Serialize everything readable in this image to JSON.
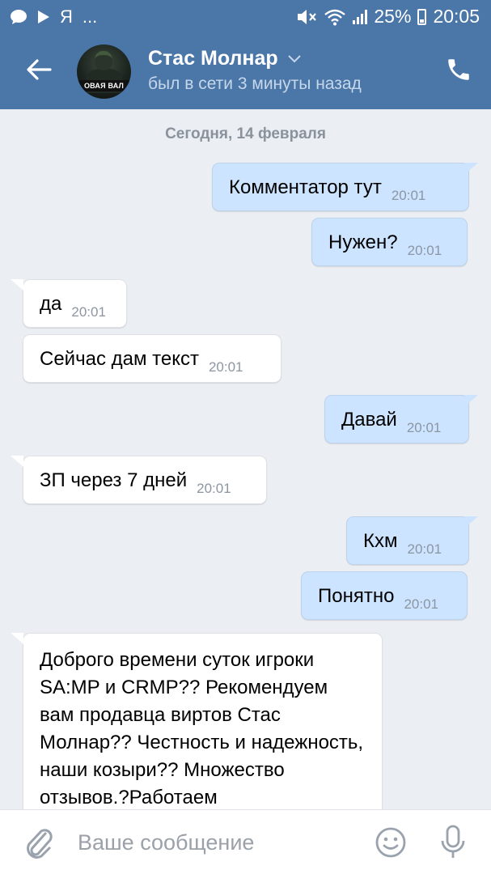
{
  "status_bar": {
    "app_letter": "Я",
    "more": "...",
    "battery_percent": "25%",
    "time": "20:05",
    "icons": [
      "chat-bubble-icon",
      "play-icon",
      "mute-icon",
      "wifi-icon",
      "signal-icon",
      "battery-icon"
    ]
  },
  "header": {
    "contact_name": "Стас Молнар",
    "contact_status": "был в сети 3 минуты назад",
    "avatar_caption": "ОВАЯ ВАЛ",
    "icons": [
      "back-arrow-icon",
      "chevron-down-icon",
      "phone-icon"
    ]
  },
  "chat": {
    "date_separator": "Сегодня, 14 февраля",
    "messages": [
      {
        "direction": "out",
        "text": "Комментатор тут",
        "time": "20:01"
      },
      {
        "direction": "out",
        "text": "Нужен?",
        "time": "20:01"
      },
      {
        "direction": "in",
        "text": "да",
        "time": "20:01"
      },
      {
        "direction": "in",
        "text": "Сейчас дам текст",
        "time": "20:01"
      },
      {
        "direction": "out",
        "text": "Давай",
        "time": "20:01"
      },
      {
        "direction": "in",
        "text": "ЗП через 7 дней",
        "time": "20:01"
      },
      {
        "direction": "out",
        "text": "Кхм",
        "time": "20:01"
      },
      {
        "direction": "out",
        "text": "Понятно",
        "time": "20:01"
      },
      {
        "direction": "in",
        "text": "Доброго времени суток игроки SA:MP и CRMP?? Рекомендуем вам продавца виртов Стас Молнар?? Честность и надежность, наши козыри?? Множество отзывов.?Работаем"
      }
    ]
  },
  "composer": {
    "placeholder": "Ваше сообщение",
    "icons": [
      "paperclip-icon",
      "emoji-icon",
      "microphone-icon"
    ]
  },
  "colors": {
    "header_bg": "#4a76a8",
    "chat_bg": "#ebeef2",
    "outgoing_bubble": "#cce4ff",
    "incoming_bubble": "#ffffff",
    "time_text": "#8c96a2"
  }
}
